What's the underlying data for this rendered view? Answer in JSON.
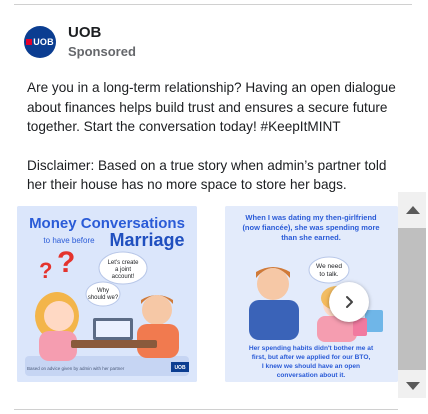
{
  "post": {
    "brand": {
      "name": "UOB",
      "logo_text": "UOB",
      "sponsored_label": "Sponsored"
    },
    "text": {
      "paragraph1": "Are you in a long-term relationship? Having an open dialogue about finances helps build trust and ensures a secure future together. Start the conversation today! #KeepItMINT",
      "paragraph2": "Disclaimer: Based on a true story when admin’s partner told her their house has no more space to store her bags."
    },
    "carousel": {
      "cards": [
        {
          "title_line1": "Money Conversations",
          "title_small": "to have before",
          "title_big": "Marriage",
          "bubble_left": "Why should we?",
          "bubble_right": "Let's create a joint account!",
          "question_marks": "?",
          "footnote": "Based on advice given by admin with her partner",
          "brand_mark": "UOB"
        },
        {
          "top_text": "When I was dating my then-girlfriend (now fiancée), she was spending more than she earned.",
          "bubble": "We need to talk.",
          "bottom_text": "Her spending habits didn't bother me at first, but after we applied for our BTO, I knew we should have an open conversation about it."
        }
      ],
      "next_icon": "chevron-right-icon"
    },
    "colors": {
      "brand_blue": "#0b3d91",
      "brand_red": "#e4002b",
      "title_blue": "#2a5bd7",
      "marriage_blue": "#1f4fbf"
    }
  }
}
